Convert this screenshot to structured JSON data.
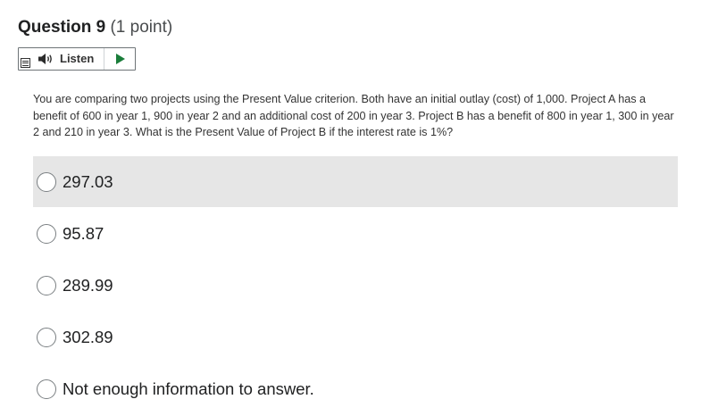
{
  "question": {
    "title": "Question 9",
    "points": "(1 point)"
  },
  "listen": {
    "label": "Listen",
    "icons": [
      "menu-icon",
      "speaker-icon",
      "play-icon"
    ],
    "play_color": "#1a7d3a"
  },
  "question_text": "You are comparing two projects using the Present Value criterion. Both have an initial outlay (cost) of 1,000.  Project A has a benefit of 600 in year 1, 900 in year 2 and an additional cost of 200 in year 3. Project B has a benefit of 800 in year 1, 300 in year 2 and 210 in year 3. What is the Present Value of Project B if the interest rate is 1%?",
  "options": [
    {
      "label": "297.03",
      "highlighted": true,
      "selected": false
    },
    {
      "label": "95.87",
      "highlighted": false,
      "selected": false
    },
    {
      "label": "289.99",
      "highlighted": false,
      "selected": false
    },
    {
      "label": "302.89",
      "highlighted": false,
      "selected": false
    },
    {
      "label": "Not enough information to answer.",
      "highlighted": false,
      "selected": false
    }
  ],
  "colors": {
    "highlight_bg": "#e6e6e6",
    "text": "#202122"
  }
}
